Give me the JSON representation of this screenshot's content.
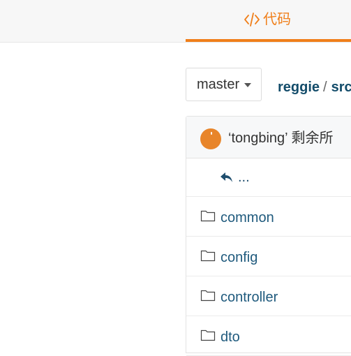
{
  "topbar": {
    "code_tab_label": "代码",
    "code_tab_icon": "code-icon",
    "accent_color": "#f07f1a"
  },
  "repo": {
    "branch": "master",
    "breadcrumb": {
      "repo_name": "reggie",
      "separator": "/",
      "path_segment": "src"
    }
  },
  "commit": {
    "avatar_icon": "user-avatar",
    "message": "‘tongbing’   剩余所"
  },
  "file_list": {
    "parent_label": "...",
    "parent_icon": "reply-back-icon",
    "items": [
      {
        "name": "common",
        "icon": "folder-icon"
      },
      {
        "name": "config",
        "icon": "folder-icon"
      },
      {
        "name": "controller",
        "icon": "folder-icon"
      },
      {
        "name": "dto",
        "icon": "folder-icon"
      }
    ]
  }
}
